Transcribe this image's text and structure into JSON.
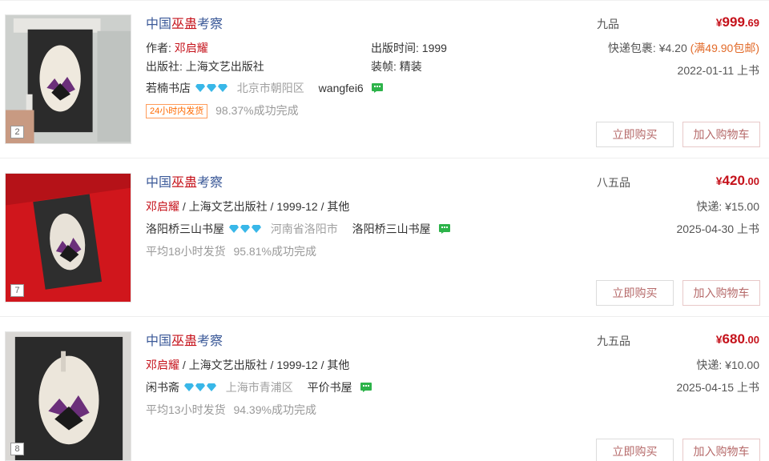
{
  "listings": [
    {
      "title_parts": [
        "中国",
        "巫蛊",
        "考察"
      ],
      "author_label": "作者: ",
      "author": "邓启耀",
      "publisher_label": "出版社: ",
      "publisher": "上海文艺出版社",
      "pubdate": "出版时间: 1999",
      "binding": "装帧: 精装",
      "shop": "若楠书店",
      "region": "北京市朝阳区",
      "nickname": "wangfei6",
      "ship_tag": "24小时内发货",
      "success_rate": "98.37%成功完成",
      "condition": "九品",
      "price_currency": "¥",
      "price_int": "999",
      "price_dec": ".69",
      "shipping": "快递包裹: ¥4.20",
      "shipping_promo": "(满49.90包邮)",
      "date": "2022-01-11 上书",
      "image_count": "2",
      "buy_label": "立即购买",
      "cart_label": "加入购物车"
    },
    {
      "title_parts": [
        "中国",
        "巫蛊",
        "考察"
      ],
      "author": "邓启耀",
      "meta": " / 上海文艺出版社 / 1999-12 / 其他",
      "shop": "洛阳桥三山书屋",
      "region": "河南省洛阳市",
      "nickname": "洛阳桥三山书屋",
      "ship_time": "平均18小时发货",
      "success_rate": "95.81%成功完成",
      "condition": "八五品",
      "price_currency": "¥",
      "price_int": "420",
      "price_dec": ".00",
      "shipping": "快递: ¥15.00",
      "date": "2025-04-30 上书",
      "image_count": "7",
      "buy_label": "立即购买",
      "cart_label": "加入购物车"
    },
    {
      "title_parts": [
        "中国",
        "巫蛊",
        "考察"
      ],
      "author": "邓启耀",
      "meta": " / 上海文艺出版社 / 1999-12 / 其他",
      "shop": "闲书斋",
      "region": "上海市青浦区",
      "nickname": "平价书屋",
      "ship_time": "平均13小时发货",
      "success_rate": "94.39%成功完成",
      "condition": "九五品",
      "price_currency": "¥",
      "price_int": "680",
      "price_dec": ".00",
      "shipping": "快递: ¥10.00",
      "date": "2025-04-15 上书",
      "image_count": "8",
      "buy_label": "立即购买",
      "cart_label": "加入购物车"
    }
  ],
  "colors": {
    "title_link": "#3b5998",
    "highlight": "#c5121b",
    "price": "#c5121b",
    "diamond": "#39b7e8",
    "chat": "#2db34a",
    "tag_orange": "#ff6a00"
  }
}
